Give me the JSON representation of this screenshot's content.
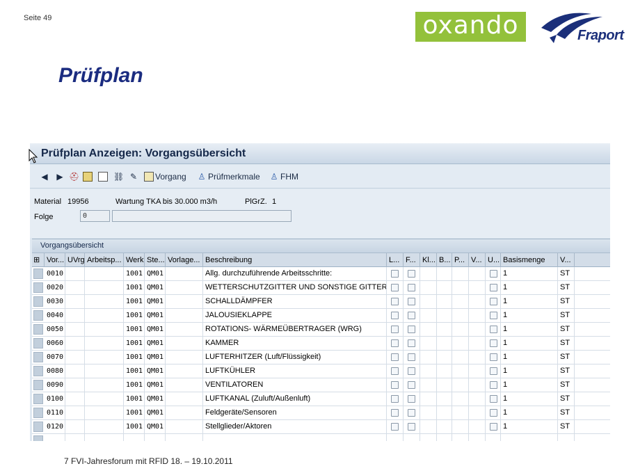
{
  "slide": {
    "number": "Seite 49",
    "title": "Prüfplan",
    "footer": "7 FVI-Jahresforum mit RFID 18. – 19.10.2011",
    "logo_oxando": "oxando",
    "logo_fraport": "Fraport"
  },
  "window": {
    "title": "Prüfplan Anzeigen: Vorgangsübersicht"
  },
  "toolbar": {
    "vorgang_label": "Vorgang",
    "pruefmerkmale_label": "Prüfmerkmale",
    "fhm_label": "FHM"
  },
  "header": {
    "material_label": "Material",
    "material_value": "19956",
    "description": "Wartung TKA bis 30.000 m3/h",
    "plgrz_label": "PlGrZ.",
    "plgrz_value": "1",
    "folge_label": "Folge",
    "folge_value": "0",
    "folge_text": ""
  },
  "grid": {
    "caption": "Vorgangsübersicht",
    "columns": [
      "Vor...",
      "UVrg",
      "Arbeitsp...",
      "Werk",
      "Ste...",
      "Vorlage...",
      "Beschreibung",
      "L...",
      "F...",
      "Kl...",
      "B...",
      "P...",
      "V...",
      "U...",
      "Basismenge",
      "V..."
    ],
    "rows": [
      {
        "vorgang": "0010",
        "werk": "1001",
        "steuer": "QM01",
        "beschreibung": "Allg. durchzuführende Arbeitsschritte:",
        "basismenge": "1",
        "einheit": "ST"
      },
      {
        "vorgang": "0020",
        "werk": "1001",
        "steuer": "QM01",
        "beschreibung": "WETTERSCHUTZGITTER UND SONSTIGE GITTER",
        "basismenge": "1",
        "einheit": "ST"
      },
      {
        "vorgang": "0030",
        "werk": "1001",
        "steuer": "QM01",
        "beschreibung": "SCHALLDÄMPFER",
        "basismenge": "1",
        "einheit": "ST"
      },
      {
        "vorgang": "0040",
        "werk": "1001",
        "steuer": "QM01",
        "beschreibung": "JALOUSIEKLAPPE",
        "basismenge": "1",
        "einheit": "ST"
      },
      {
        "vorgang": "0050",
        "werk": "1001",
        "steuer": "QM01",
        "beschreibung": "ROTATIONS- WÄRMEÜBERTRAGER (WRG)",
        "basismenge": "1",
        "einheit": "ST"
      },
      {
        "vorgang": "0060",
        "werk": "1001",
        "steuer": "QM01",
        "beschreibung": "KAMMER",
        "basismenge": "1",
        "einheit": "ST"
      },
      {
        "vorgang": "0070",
        "werk": "1001",
        "steuer": "QM01",
        "beschreibung": "LUFTERHITZER (Luft/Flüssigkeit)",
        "basismenge": "1",
        "einheit": "ST"
      },
      {
        "vorgang": "0080",
        "werk": "1001",
        "steuer": "QM01",
        "beschreibung": "LUFTKÜHLER",
        "basismenge": "1",
        "einheit": "ST"
      },
      {
        "vorgang": "0090",
        "werk": "1001",
        "steuer": "QM01",
        "beschreibung": "VENTILATOREN",
        "basismenge": "1",
        "einheit": "ST"
      },
      {
        "vorgang": "0100",
        "werk": "1001",
        "steuer": "QM01",
        "beschreibung": "LUFTKANAL (Zuluft/Außenluft)",
        "basismenge": "1",
        "einheit": "ST"
      },
      {
        "vorgang": "0110",
        "werk": "1001",
        "steuer": "QM01",
        "beschreibung": "Feldgeräte/Sensoren",
        "basismenge": "1",
        "einheit": "ST"
      },
      {
        "vorgang": "0120",
        "werk": "1001",
        "steuer": "QM01",
        "beschreibung": "Stellglieder/Aktoren",
        "basismenge": "1",
        "einheit": "ST"
      }
    ]
  }
}
